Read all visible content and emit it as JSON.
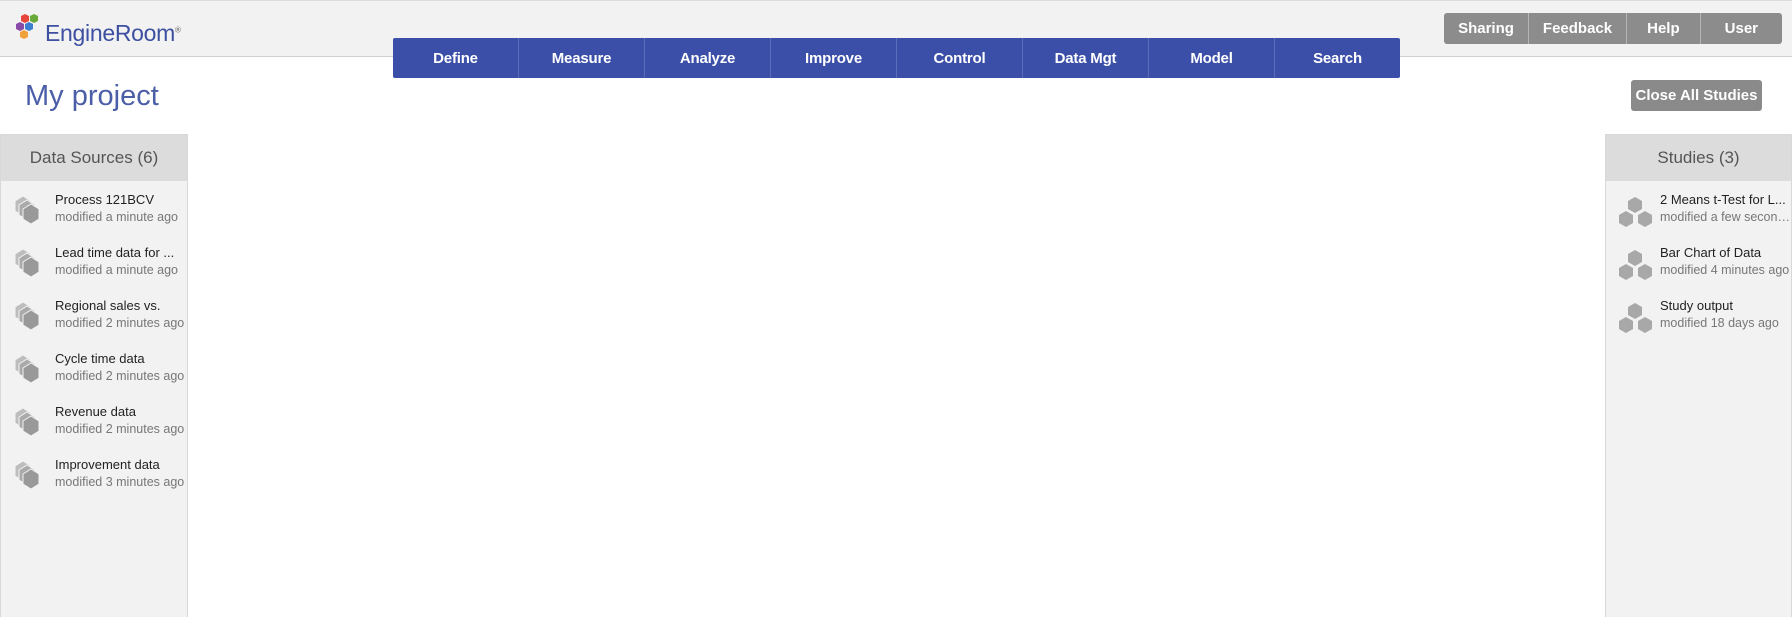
{
  "app": {
    "logo_text": "EngineRoom",
    "logo_mark": "®"
  },
  "top_buttons": [
    {
      "label": "Sharing"
    },
    {
      "label": "Feedback"
    },
    {
      "label": "Help"
    },
    {
      "label": "User"
    }
  ],
  "nav": [
    {
      "label": "Define"
    },
    {
      "label": "Measure"
    },
    {
      "label": "Analyze"
    },
    {
      "label": "Improve"
    },
    {
      "label": "Control"
    },
    {
      "label": "Data Mgt"
    },
    {
      "label": "Model"
    },
    {
      "label": "Search"
    }
  ],
  "project": {
    "title": "My project",
    "close_all_label": "Close All Studies"
  },
  "data_sources": {
    "header": "Data Sources (6)",
    "items": [
      {
        "name": "Process 121BCV",
        "modified": "modified a minute ago",
        "icon": "data-source-icon"
      },
      {
        "name": "Lead time data for ...",
        "modified": "modified a minute ago",
        "icon": "data-source-icon"
      },
      {
        "name": "Regional sales vs.",
        "modified": "modified 2 minutes ago",
        "icon": "data-source-icon"
      },
      {
        "name": "Cycle time data",
        "modified": "modified 2 minutes ago",
        "icon": "data-source-icon"
      },
      {
        "name": "Revenue data",
        "modified": "modified 2 minutes ago",
        "icon": "data-source-icon"
      },
      {
        "name": "Improvement data",
        "modified": "modified 3 minutes ago",
        "icon": "data-source-icon"
      }
    ]
  },
  "studies": {
    "header": "Studies (3)",
    "items": [
      {
        "name": "2 Means t-Test for L...",
        "modified": "modified a few second...",
        "icon": "study-icon"
      },
      {
        "name": "Bar Chart of Data",
        "modified": "modified 4 minutes ago",
        "icon": "study-icon"
      },
      {
        "name": "Study output",
        "modified": "modified 18 days ago",
        "icon": "study-icon"
      }
    ]
  },
  "colors": {
    "nav_bg": "#3c4fa8",
    "title": "#4b5ea8",
    "button_gray": "#8a8a8a",
    "logo_red": "#e8463a",
    "logo_blue": "#3c7fd0",
    "logo_orange": "#f2a23a",
    "logo_green": "#6aaa3a"
  }
}
